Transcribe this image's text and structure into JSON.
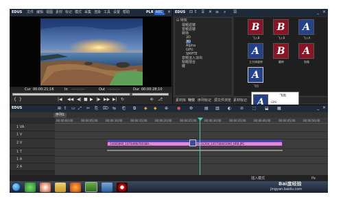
{
  "app_name": "EDUS",
  "menu": [
    "文件",
    "编辑",
    "视图",
    "素材",
    "标记",
    "模式",
    "采集",
    "渲染",
    "工具",
    "设置",
    "帮助"
  ],
  "player": {
    "label": "PLR",
    "rec_label": "REC",
    "cur_label": "Cur",
    "cur_time": "00:00:21;16",
    "in_label": "In",
    "in_time": "--:--:--;--",
    "out_label": "Out",
    "out_time": "--:--:--;--",
    "dur_label": "Dur",
    "dur_time": "00:00:28;10"
  },
  "right_panel": {
    "app_name": "EDUS",
    "folders": [
      "视频滤镜",
      "音频滤镜",
      "转场",
      "2D",
      "3D",
      "Alpha",
      "GPU",
      "SMPTE",
      "音频淡入淡出",
      "标题混合",
      "键"
    ],
    "effects": [
      {
        "glyph": "B",
        "label": "飞入B"
      },
      {
        "glyph": "B",
        "label": "飞入B"
      },
      {
        "glyph": "A",
        "label": "飞入A"
      },
      {
        "glyph": "A",
        "label": "立方体旋转"
      },
      {
        "glyph": "B",
        "label": "翻转"
      },
      {
        "glyph": "A",
        "label": "划像"
      },
      {
        "glyph": "A",
        "label": "飞出"
      }
    ],
    "tabs": [
      "素材库",
      "特效",
      "序列标记",
      "源文件浏览",
      "素材标记"
    ],
    "tooltip_title": "飞出",
    "tooltip_line1": "GPU",
    "tooltip_line2": "4000 fx, 标准"
  },
  "timeline": {
    "app_name": "EDUS",
    "sequence_tab": "序列1",
    "ruler_ticks": [
      "00:00:00;00",
      "00:00:05;00",
      "00:00:10;00",
      "00:00:15;00",
      "00:00:20;00",
      "00:00:25;00",
      "00:00:30;00",
      "00:00:35;00",
      "00:00:40;00",
      "00:00:45;00",
      "00:00:50;00"
    ],
    "tracks": [
      "1 VA",
      "1 V",
      "2 V",
      "1 T",
      "1 A",
      "2 A"
    ],
    "clip1_label": "14483890_1474d9fb760389...",
    "clip2_label": "20131204_141738441090_HRB.JPG",
    "status_left": "插入模式",
    "status_right": "Pa"
  },
  "taskbar": {
    "icons": [
      "start-orb",
      "ie",
      "media",
      "folder",
      "firefox",
      "edius",
      "explorer",
      "recorder"
    ],
    "watermark_line1": "Bai度经验",
    "watermark_line2": "jingyan.baidu.com"
  },
  "colors": {
    "clip_pink": "#e089d8",
    "clip_header_blue": "#3b4aa8",
    "playhead": "#3fd1b8",
    "fx_red": "#8a1426",
    "fx_blue": "#23428a"
  }
}
